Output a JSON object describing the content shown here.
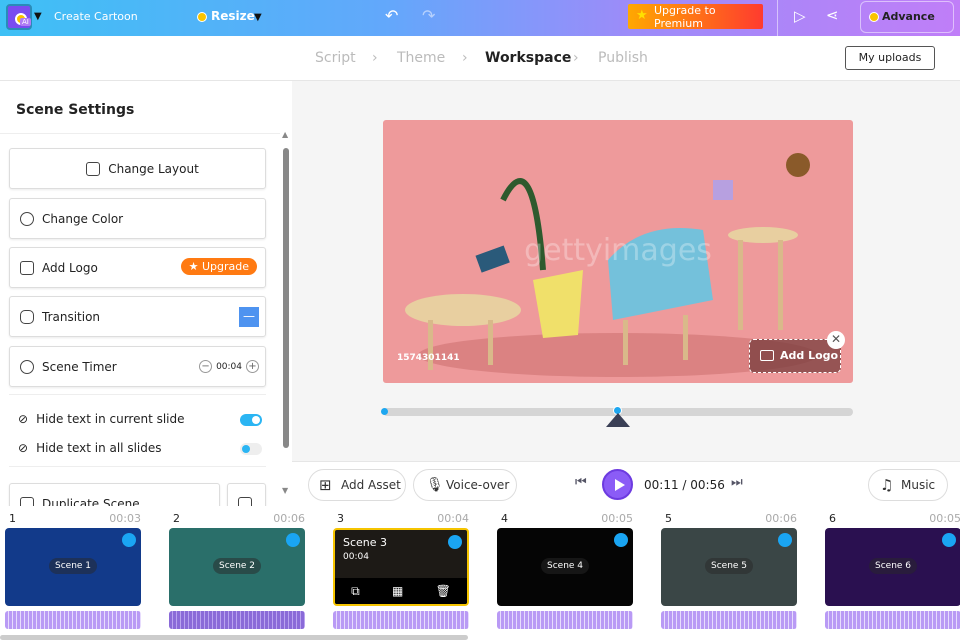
{
  "topbar": {
    "app_name": "Create Cartoon",
    "resize": "Resize",
    "upgrade": "Upgrade to Premium",
    "advance_edit": "Advance Edit",
    "logo_badge": "AI"
  },
  "steps": [
    "Script",
    "Theme",
    "Workspace",
    "Publish"
  ],
  "active_step": "Workspace",
  "my_uploads": "My uploads",
  "panel": {
    "title": "Scene Settings",
    "change_layout": "Change Layout",
    "change_color": "Change Color",
    "add_logo": "Add Logo",
    "upgrade": "★ Upgrade",
    "transition": "Transition",
    "transition_value": "—",
    "scene_timer": "Scene Timer",
    "timer_value": "00:04",
    "hide_current": "Hide text in current slide",
    "hide_current_on": true,
    "hide_all": "Hide text in all slides",
    "hide_all_on": false,
    "duplicate": "Duplicate Scene"
  },
  "canvas": {
    "image_id": "1574301141",
    "watermark": "gettyimages",
    "add_logo": "Add Logo"
  },
  "playback": {
    "progress": 0.5,
    "current": "00:11",
    "total": "00:56",
    "time_text": "00:11 / 00:56"
  },
  "controls": {
    "add_asset": "Add Asset",
    "voice_over": "Voice-over",
    "music": "Music"
  },
  "scenes": [
    {
      "num": "1",
      "duration": "00:03",
      "label": "Scene 1",
      "color": "#123a8a"
    },
    {
      "num": "2",
      "duration": "00:06",
      "label": "Scene 2",
      "color": "#2a6f6a"
    },
    {
      "num": "3",
      "duration": "00:04",
      "label": "Scene 3",
      "color": "#1d1a16"
    },
    {
      "num": "4",
      "duration": "00:05",
      "label": "Scene 4",
      "color": "#050505"
    },
    {
      "num": "5",
      "duration": "00:06",
      "label": "Scene 5",
      "color": "#3a4646"
    },
    {
      "num": "6",
      "duration": "00:05",
      "label": "Scene 6",
      "color": "#2a1050"
    }
  ],
  "selected_scene": {
    "title": "Scene 3",
    "duration": "00:04"
  }
}
